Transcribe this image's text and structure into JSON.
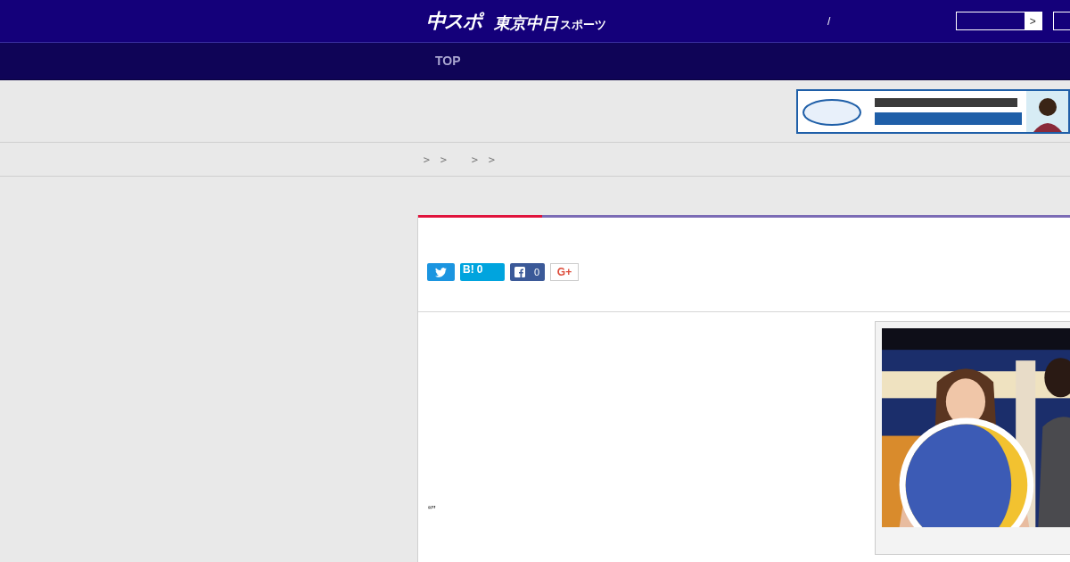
{
  "header": {
    "logo_main": "中スポ",
    "logo_sub": "東京中日",
    "logo_small": "スポーツ",
    "divider_text": "/",
    "search_button": ">"
  },
  "nav": {
    "items": [
      {
        "label": "TOP",
        "selected": false
      }
    ]
  },
  "breadcrumb": {
    "separators": [
      "＞",
      "＞",
      "＞",
      "＞"
    ]
  },
  "share": {
    "hatena": {
      "label": "B!",
      "count": "0"
    },
    "facebook": {
      "count": "0"
    },
    "google": {
      "label": "G+"
    }
  },
  "article": {
    "quote": "“”"
  }
}
